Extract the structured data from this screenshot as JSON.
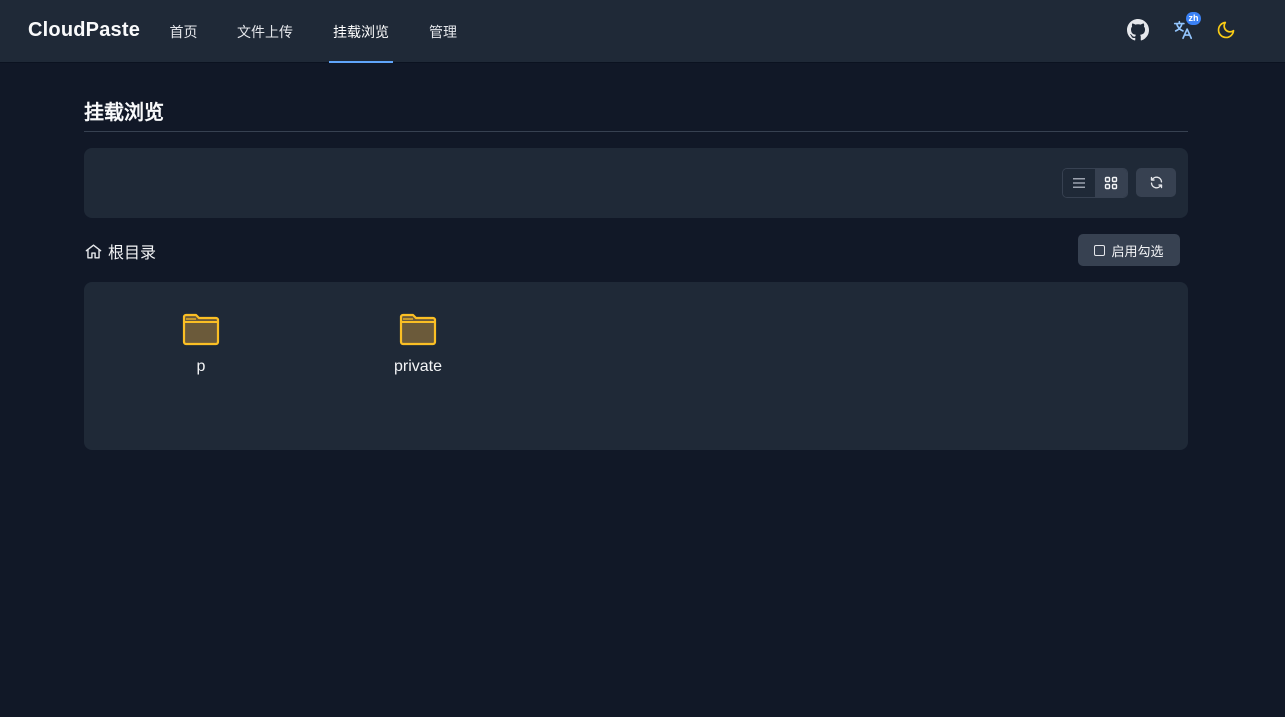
{
  "header": {
    "brand": "CloudPaste",
    "nav": [
      {
        "label": "首页"
      },
      {
        "label": "文件上传"
      },
      {
        "label": "挂载浏览"
      },
      {
        "label": "管理"
      }
    ],
    "lang_badge": "zh",
    "icons": [
      "github-icon",
      "translate-icon",
      "moon-icon"
    ]
  },
  "main": {
    "title": "挂载浏览",
    "breadcrumb": {
      "icon": "home-icon",
      "label": "根目录"
    },
    "select_toggle_label": "启用勾选",
    "view_modes": [
      "list-view",
      "grid-view"
    ],
    "active_view": "grid-view",
    "items": [
      {
        "name": "p",
        "type": "folder"
      },
      {
        "name": "private",
        "type": "folder"
      }
    ]
  },
  "colors": {
    "background": "#111827",
    "surface": "#1f2937",
    "accent": "#60a5fa",
    "folder": "#fbbf24",
    "moon": "#facc15"
  }
}
